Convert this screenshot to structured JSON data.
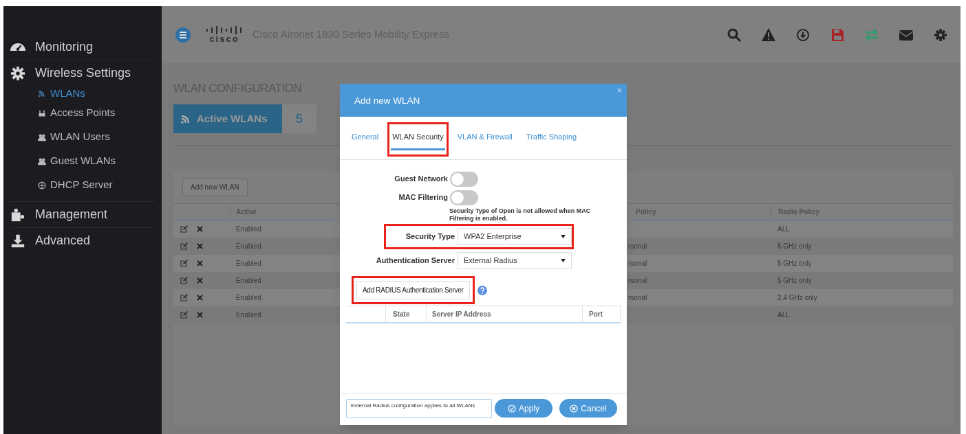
{
  "sidebar": {
    "sections": [
      {
        "label": "Monitoring"
      },
      {
        "label": "Wireless Settings",
        "children": [
          {
            "label": "WLANs",
            "selected": true
          },
          {
            "label": "Access Points",
            "selected": false
          },
          {
            "label": "WLAN Users",
            "selected": false
          },
          {
            "label": "Guest WLANs",
            "selected": false
          },
          {
            "label": "DHCP Server",
            "selected": false
          }
        ]
      },
      {
        "label": "Management"
      },
      {
        "label": "Advanced"
      }
    ]
  },
  "header": {
    "logo": "cisco",
    "title": "Cisco Aironet 1830 Series Mobility Express"
  },
  "content": {
    "heading": "WLAN CONFIGURATION",
    "active_wlans": {
      "label": "Active WLANs",
      "count": "5"
    },
    "add_button": "Add new WLAN",
    "table": {
      "columns": [
        "Active",
        "Policy",
        "Radio Policy"
      ],
      "rows": [
        {
          "active": "Enabled",
          "radio_policy": "ALL"
        },
        {
          "active": "Enabled",
          "policy": "rsonal",
          "radio_policy": "5 GHz only"
        },
        {
          "active": "Enabled",
          "policy": "rsonal",
          "radio_policy": "5 GHz only"
        },
        {
          "active": "Enabled",
          "policy": "rsonal",
          "radio_policy": "5 GHz only"
        },
        {
          "active": "Enabled",
          "policy": "rsonal",
          "radio_policy": "2.4 GHz only"
        },
        {
          "active": "Enabled",
          "radio_policy": "ALL"
        }
      ]
    }
  },
  "modal": {
    "title": "Add new WLAN",
    "close": "×",
    "tabs": [
      {
        "label": "General",
        "selected": false,
        "highlighted": false
      },
      {
        "label": "WLAN Security",
        "selected": true,
        "highlighted": true
      },
      {
        "label": "VLAN & Firewall",
        "selected": false,
        "highlighted": false
      },
      {
        "label": "Traffic Shaping",
        "selected": false,
        "highlighted": false
      }
    ],
    "toggles": [
      {
        "label": "Guest Network",
        "on": false
      },
      {
        "label": "MAC Filtering",
        "on": false
      }
    ],
    "note": "Security Type of Open is not allowed when MAC Filtering is enabled.",
    "fields": [
      {
        "label": "Security Type",
        "value": "WPA2 Enterprise",
        "highlighted": true
      },
      {
        "label": "Authentication Server",
        "value": "External Radius",
        "highlighted": false
      }
    ],
    "add_server_button": {
      "label": "Add RADIUS Authentication Server",
      "highlighted": true
    },
    "server_table": {
      "columns": [
        "State",
        "Server IP Address",
        "Port"
      ]
    },
    "footer_note": "External Radius configuration applies to all WLANs",
    "buttons": [
      {
        "label": "Apply",
        "kind": "apply"
      },
      {
        "label": "Cancel",
        "kind": "cancel"
      }
    ]
  }
}
